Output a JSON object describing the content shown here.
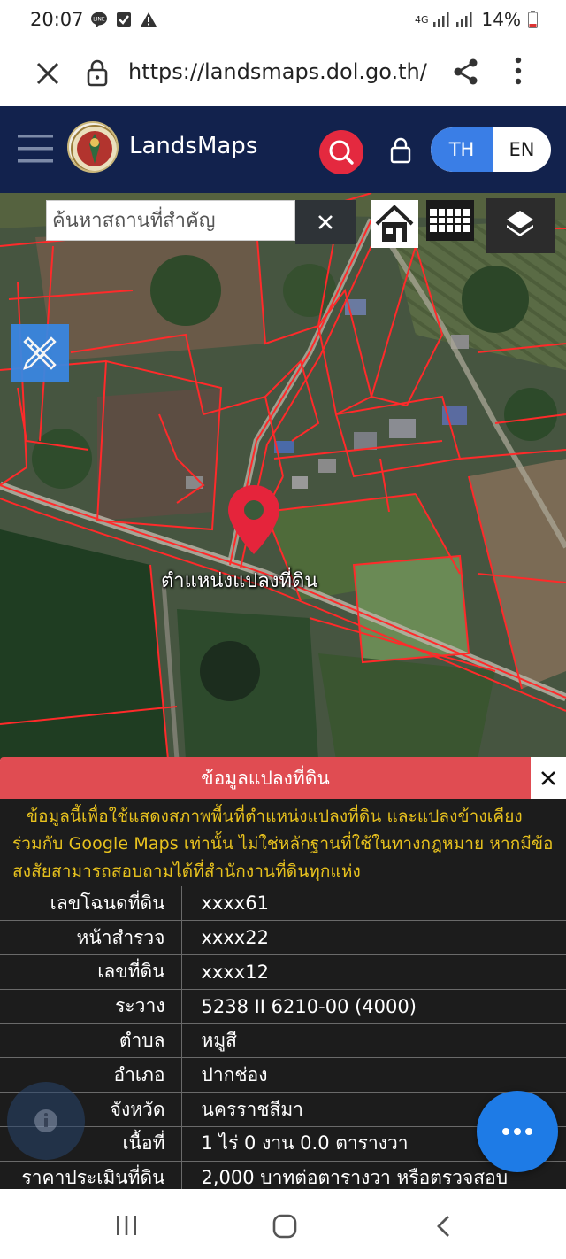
{
  "status_bar": {
    "time": "20:07",
    "left_icons": [
      "line-icon",
      "check-icon",
      "warning-icon"
    ],
    "network": "4G",
    "battery": "14%"
  },
  "browser": {
    "url": "https://landsmaps.dol.go.th/",
    "icons": [
      "close-icon",
      "lock-icon",
      "share-icon",
      "more-vert-icon"
    ]
  },
  "header": {
    "title": "LandsMaps",
    "lang_th": "TH",
    "lang_en": "EN",
    "bg_color": "#12224d",
    "search_color": "#e4293f",
    "active_lang_color": "#3a7ee6"
  },
  "map": {
    "search_placeholder": "ค้นหาสถานที่สำคัญ",
    "marker_label": "ตำแหน่งแปลงที่ดิน",
    "parcel_line_color": "#ff2a2a",
    "buttons": [
      "close-icon",
      "home-icon",
      "grid-icon",
      "layers-icon",
      "ruler-pencil-icon"
    ]
  },
  "info_panel": {
    "title": "ข้อมูลแปลงที่ดิน",
    "title_bg": "#e04c52",
    "disclaimer": "ข้อมูลนี้เพื่อใช้แสดงสภาพพื้นที่ตำแหน่งแปลงที่ดิน และแปลงข้างเคียง ร่วมกับ Google Maps เท่านั้น ไม่ใช่หลักฐานที่ใช้ในทางกฎหมาย หากมีข้อสงสัยสามารถสอบถามได้ที่สำนักงานที่ดินทุกแห่ง",
    "disclaimer_color": "#e8c21e",
    "rows": [
      {
        "label": "เลขโฉนดที่ดิน",
        "value": "xxxx61"
      },
      {
        "label": "หน้าสำรวจ",
        "value": "xxxx22"
      },
      {
        "label": "เลขที่ดิน",
        "value": "xxxx12"
      },
      {
        "label": "ระวาง",
        "value": "5238 II 6210-00 (4000)"
      },
      {
        "label": "ตำบล",
        "value": "หมูสี"
      },
      {
        "label": "อำเภอ",
        "value": "ปากช่อง"
      },
      {
        "label": "จังหวัด",
        "value": "นครราชสีมา"
      },
      {
        "label": "เนื้อที่",
        "value": "1 ไร่ 0 งาน 0.0 ตารางวา"
      },
      {
        "label": "ราคาประเมินที่ดิน",
        "value": "2,000 บาทต่อตารางวา หรือตรวจสอบ"
      }
    ]
  },
  "fab": {
    "info_icon": "info-icon",
    "more_icon": "more-horiz-icon"
  },
  "nav_bar": {
    "icons": [
      "recents-icon",
      "home-icon",
      "back-icon"
    ]
  }
}
